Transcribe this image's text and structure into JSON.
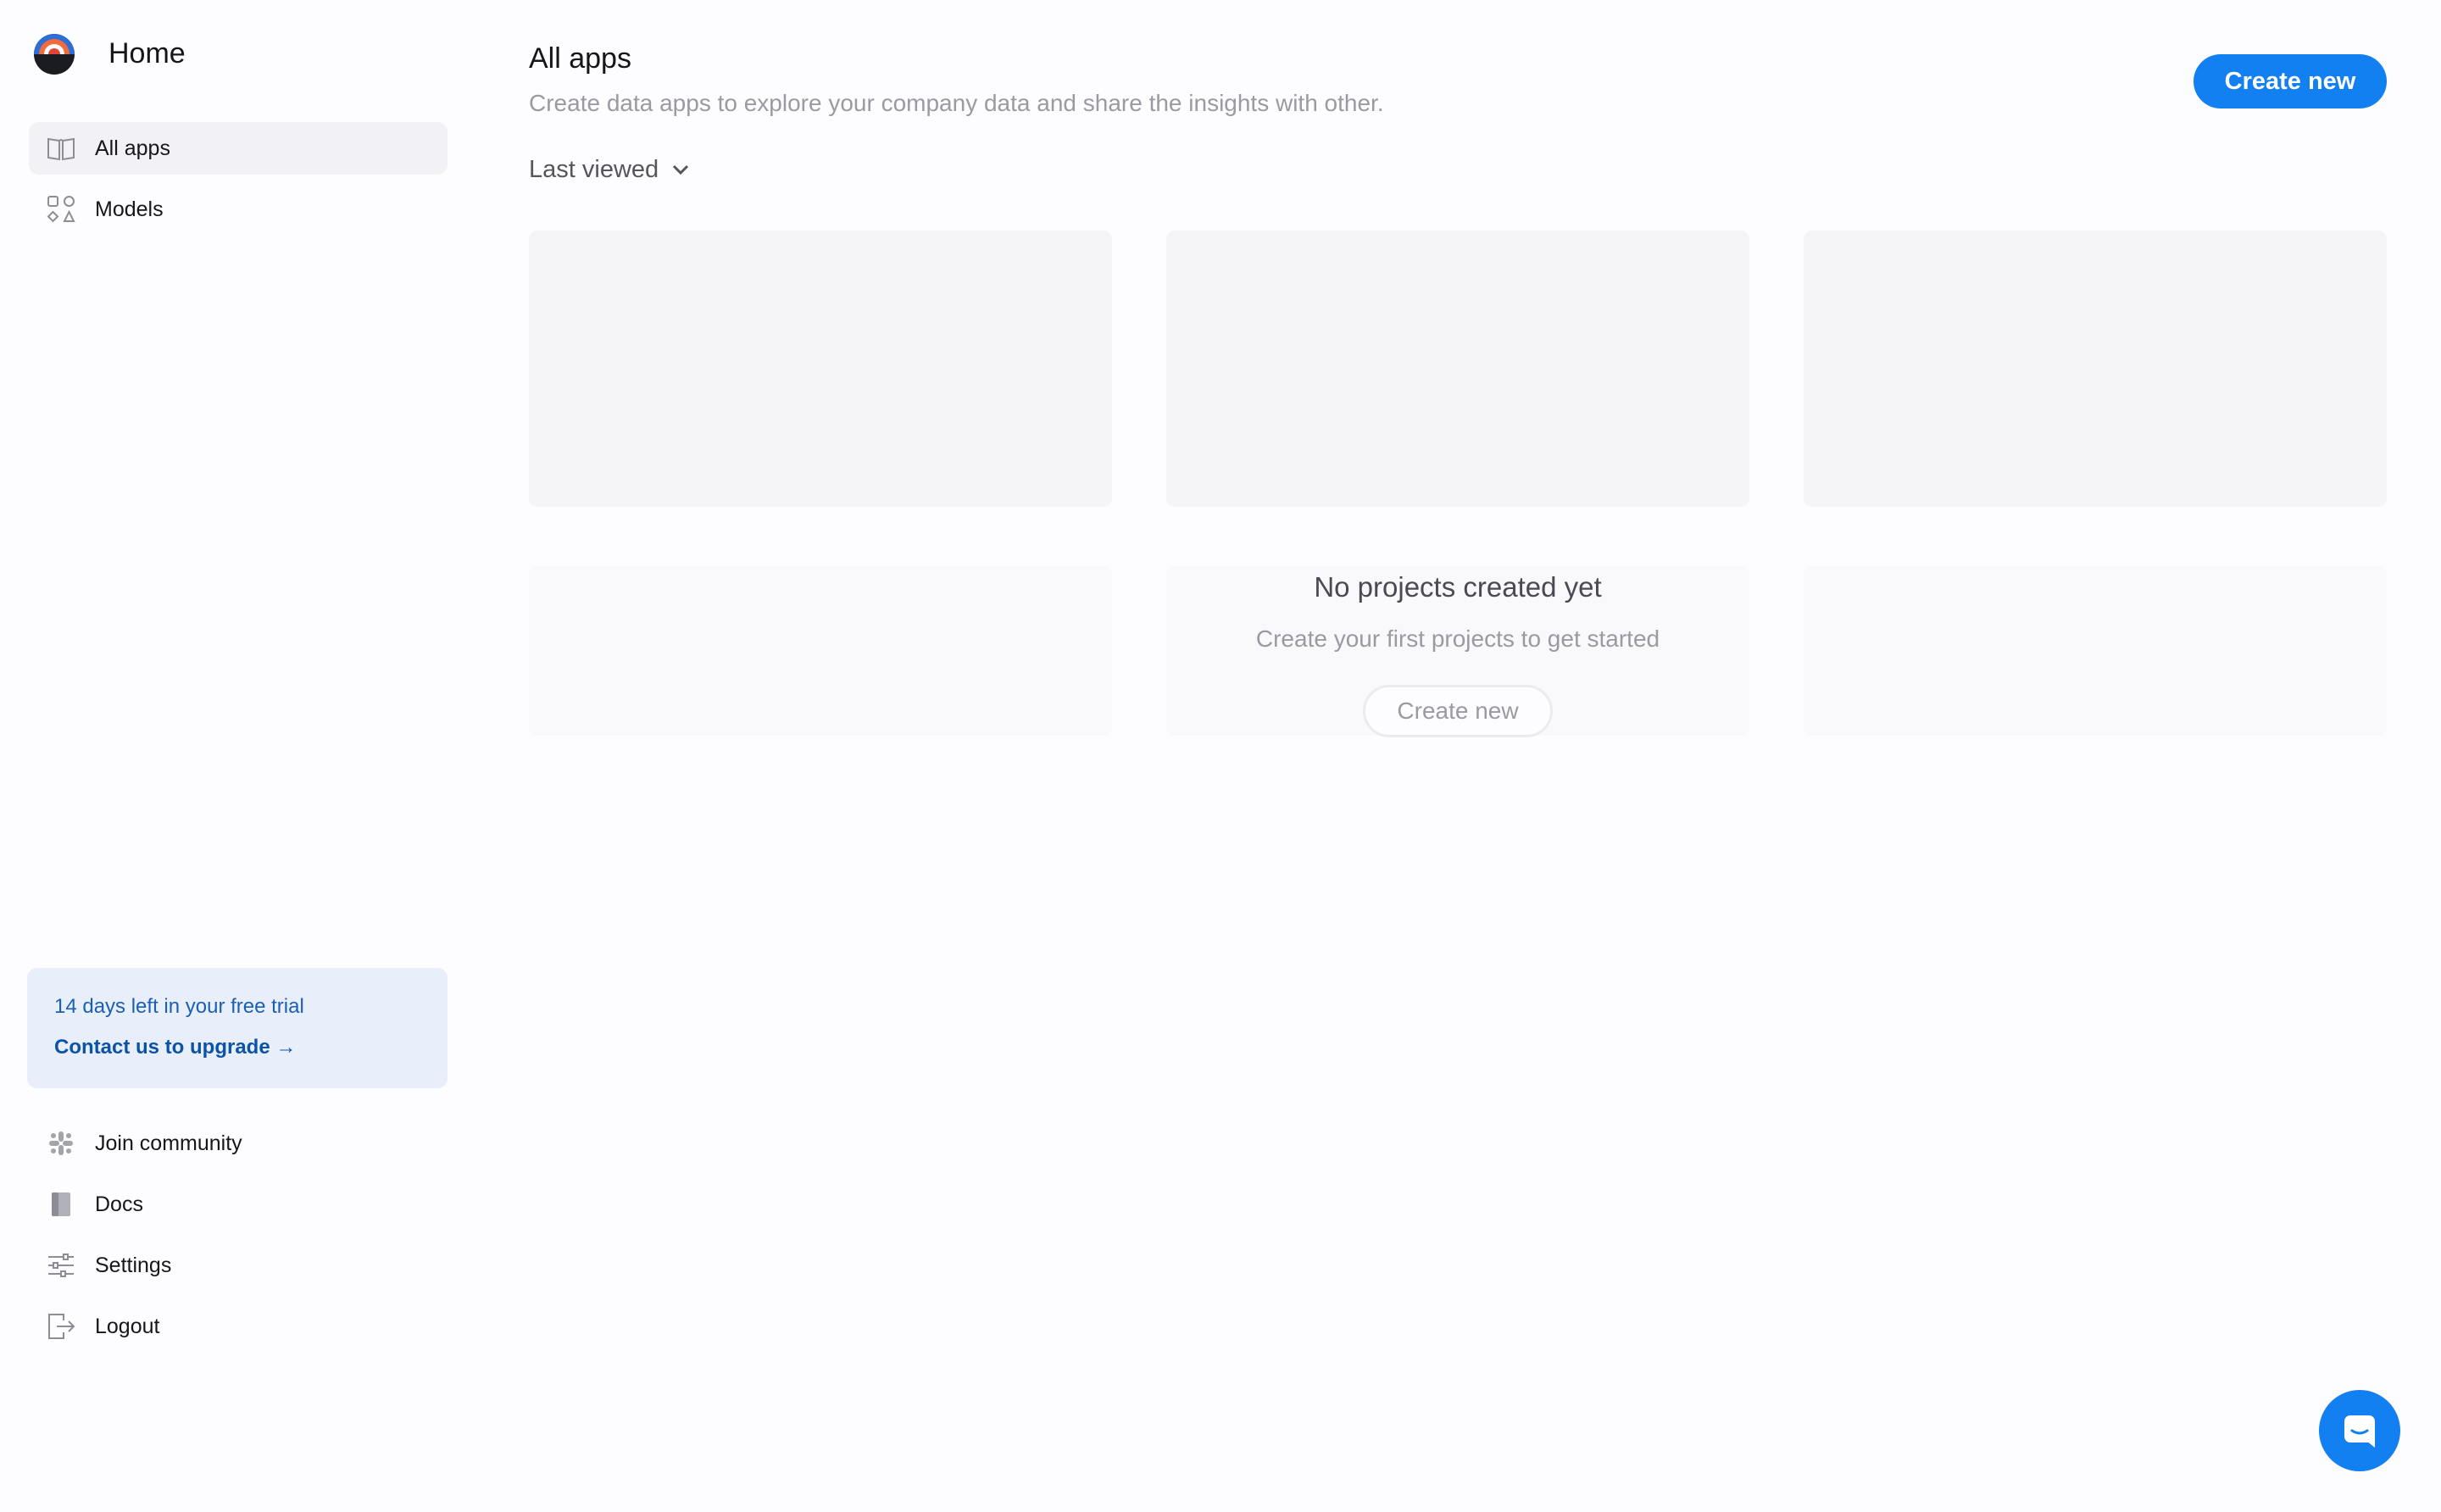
{
  "sidebar": {
    "brand_title": "Home",
    "nav": [
      {
        "label": "All apps",
        "icon": "book-open-icon",
        "active": true
      },
      {
        "label": "Models",
        "icon": "shapes-icon",
        "active": false
      }
    ],
    "trial": {
      "text": "14 days left in your free trial",
      "link": "Contact us to upgrade →"
    },
    "footer_nav": [
      {
        "label": "Join community",
        "icon": "slack-icon"
      },
      {
        "label": "Docs",
        "icon": "docs-book-icon"
      },
      {
        "label": "Settings",
        "icon": "sliders-icon"
      },
      {
        "label": "Logout",
        "icon": "logout-icon"
      }
    ]
  },
  "main": {
    "title": "All apps",
    "subtitle": "Create data apps to explore your company data and share the insights with other.",
    "sort_label": "Last viewed",
    "create_button": "Create new",
    "empty_state": {
      "title": "No projects created yet",
      "subtitle": "Create your first projects to get started",
      "button": "Create new"
    }
  },
  "colors": {
    "accent": "#1280f0",
    "trial_bg": "#e8effb",
    "trial_text": "#1a5fb4",
    "active_nav_bg": "#f2f1f5",
    "placeholder_card": "#f5f4f7"
  },
  "chat_widget_icon": "chat-bubble-icon"
}
